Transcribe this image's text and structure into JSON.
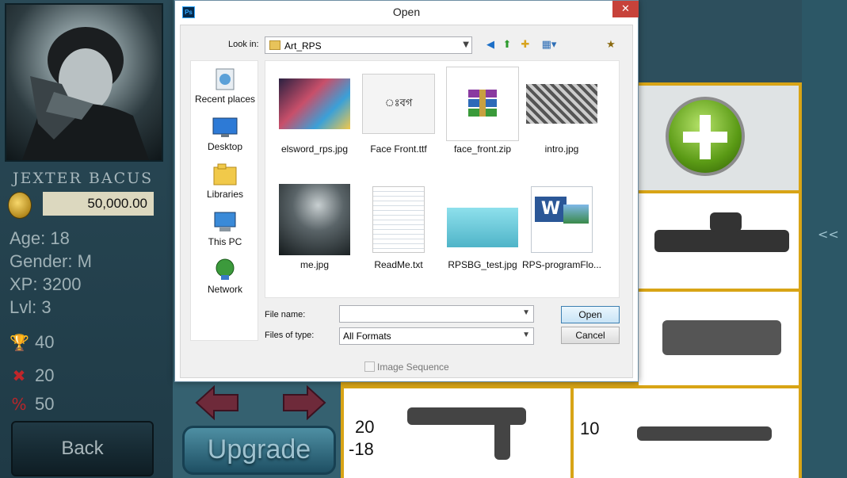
{
  "game": {
    "player_name": "JEXTER BACUS",
    "coins": "50,000.00",
    "age": "Age: 18",
    "gender": "Gender: M",
    "xp": "XP: 3200",
    "lvl": "Lvl: 3",
    "wins": "40",
    "losses": "20",
    "percent": "50",
    "back_label": "Back",
    "upgrade_label": "Upgrade",
    "cell_a_top": "20",
    "cell_a_bottom": "-18",
    "cell_b": "10",
    "side_chevron": "<<"
  },
  "dialog": {
    "title": "Open",
    "app_icon": "Ps",
    "look_in_label": "Look in:",
    "look_in_value": "Art_RPS",
    "places": [
      {
        "label": "Recent places",
        "icon": "recent-places-icon"
      },
      {
        "label": "Desktop",
        "icon": "desktop-icon"
      },
      {
        "label": "Libraries",
        "icon": "libraries-icon"
      },
      {
        "label": "This PC",
        "icon": "this-pc-icon"
      },
      {
        "label": "Network",
        "icon": "network-icon"
      }
    ],
    "files": [
      {
        "name": "elsword_rps.jpg"
      },
      {
        "name": "Face Front.ttf"
      },
      {
        "name": "face_front.zip"
      },
      {
        "name": "intro.jpg"
      },
      {
        "name": "me.jpg"
      },
      {
        "name": "ReadMe.txt"
      },
      {
        "name": "RPSBG_test.jpg"
      },
      {
        "name": "RPS-programFlo..."
      }
    ],
    "font_glyph": "ঃবগ",
    "file_name_label": "File name:",
    "file_name_value": "",
    "files_of_type_label": "Files of type:",
    "files_of_type_value": "All Formats",
    "open_label": "Open",
    "cancel_label": "Cancel",
    "image_sequence_label": "Image Sequence"
  }
}
